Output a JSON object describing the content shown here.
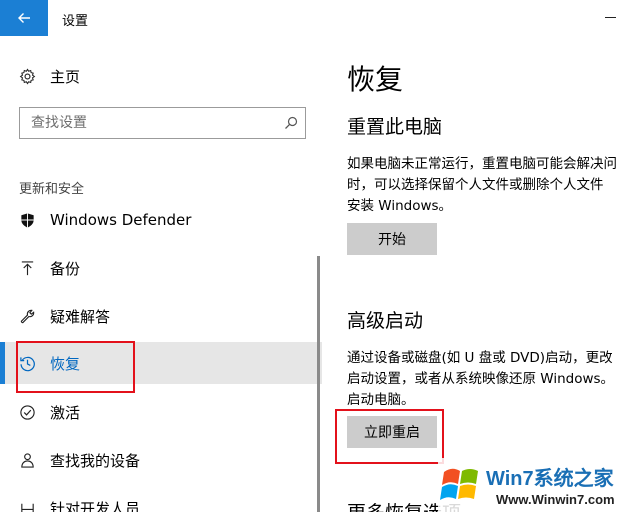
{
  "window": {
    "title": "设置"
  },
  "sidebar": {
    "home_label": "主页",
    "search_placeholder": "查找设置",
    "section_label": "更新和安全",
    "items": [
      {
        "label": "Windows Defender",
        "icon": "shield-icon"
      },
      {
        "label": "备份",
        "icon": "upload-arrow-icon"
      },
      {
        "label": "疑难解答",
        "icon": "wrench-icon"
      },
      {
        "label": "恢复",
        "icon": "history-icon",
        "active": true
      },
      {
        "label": "激活",
        "icon": "check-circle-icon"
      },
      {
        "label": "查找我的设备",
        "icon": "person-locate-icon"
      },
      {
        "label": "针对开发人员",
        "icon": "developer-icon"
      }
    ]
  },
  "main": {
    "title": "恢复",
    "reset": {
      "heading": "重置此电脑",
      "desc_lines": [
        "如果电脑未正常运行，重置电脑可能会解决问",
        "时，可以选择保留个人文件或删除个人文件",
        "安装 Windows。"
      ],
      "button": "开始"
    },
    "advanced": {
      "heading": "高级启动",
      "desc_lines": [
        "通过设备或磁盘(如 U 盘或 DVD)启动，更改",
        "启动设置，或者从系统映像还原 Windows。",
        "启动电脑。"
      ],
      "button": "立即重启"
    },
    "more": {
      "heading": "更多恢复选项"
    }
  },
  "watermark": {
    "brand": "Win7系统之家",
    "url": "Www.Winwin7.com"
  },
  "colors": {
    "accent": "#1b7fd4",
    "highlight": "#e3111b",
    "button_bg": "#cccccc",
    "active_bg": "#e6e6e6"
  }
}
